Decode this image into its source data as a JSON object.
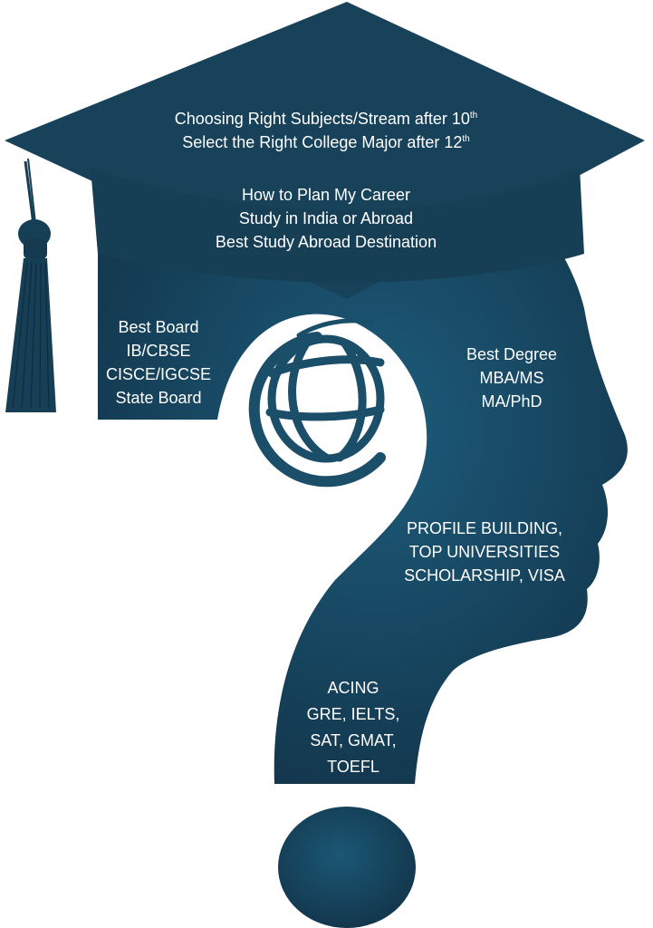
{
  "colors": {
    "silhouette_dark": "#14384e",
    "silhouette_light": "#1b5774",
    "text": "#ffffff",
    "background": "#ffffff"
  },
  "cap_text": {
    "line1": "Choosing Right Subjects/Stream after 10",
    "line1_sup": "th",
    "line2": "Select the Right College Major after 12",
    "line2_sup": "th"
  },
  "career_text": {
    "line1": "How to Plan My Career",
    "line2": "Study in India or Abroad",
    "line3": "Best Study Abroad Destination"
  },
  "board_text": {
    "line1": "Best Board",
    "line2": "IB/CBSE",
    "line3": "CISCE/IGCSE",
    "line4": "State Board"
  },
  "degree_text": {
    "line1": "Best Degree",
    "line2": "MBA/MS",
    "line3": "MA/PhD"
  },
  "profile_text": {
    "line1": "PROFILE BUILDING,",
    "line2": "TOP UNIVERSITIES",
    "line3": "SCHOLARSHIP, VISA"
  },
  "tests_text": {
    "line1": "ACING",
    "line2": "GRE, IELTS,",
    "line3": "SAT, GMAT,",
    "line4": "TOEFL"
  },
  "icons": {
    "center": "globe-icon",
    "tassel": "tassel-icon",
    "dot": "question-dot"
  }
}
